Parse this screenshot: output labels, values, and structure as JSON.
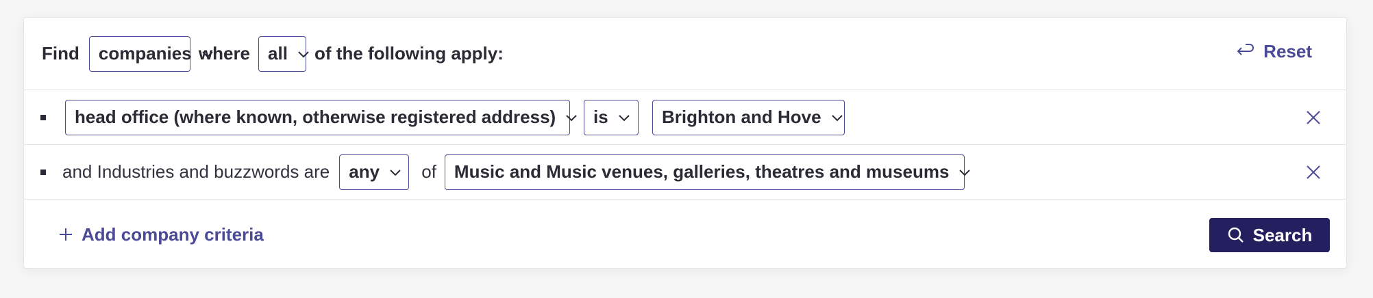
{
  "header": {
    "find_label": "Find",
    "entity_select": "companies",
    "where_label": "where",
    "match_select": "all",
    "suffix_label": "of the following apply:",
    "reset_label": "Reset"
  },
  "criteria": [
    {
      "field_select": "head office (where known, otherwise registered address)",
      "operator_select": "is",
      "value_select": "Brighton and Hove"
    },
    {
      "prefix_text": "and Industries and buzzwords are",
      "quantifier_select": "any",
      "of_label": "of",
      "value_select": "Music and Music venues, galleries, theatres and museums"
    }
  ],
  "footer": {
    "add_label": "Add company criteria",
    "search_label": "Search"
  },
  "colors": {
    "accent": "#4b4a96",
    "primary_button": "#24205f",
    "text": "#2b2b36",
    "border": "#e3e3e8"
  },
  "icons": {
    "chevron": "chevron-down-icon",
    "reset": "return-arrow-icon",
    "remove": "close-icon",
    "add": "plus-icon",
    "search": "search-icon"
  }
}
